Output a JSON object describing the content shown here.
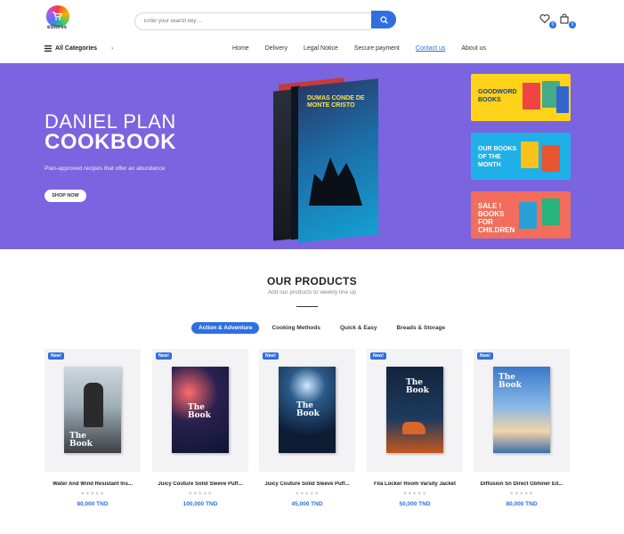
{
  "header": {
    "logo_text": "eStores",
    "search_placeholder": "Enter your search key ...",
    "wishlist_count": "0",
    "cart_count": "0"
  },
  "nav": {
    "all_categories": "All Categories",
    "links": [
      "Home",
      "Delivery",
      "Legal Notice",
      "Secure payment",
      "Contact us",
      "About us"
    ],
    "active": "Contact us"
  },
  "hero": {
    "title_line1": "DANIEL PLAN",
    "title_line2": "COOKBOOK",
    "subtitle": "Plan-approved recipes that offer an abundance",
    "cta": "SHOP NOW",
    "book_title": "DUMAS CONDE DE MONTE CRISTO",
    "promos": [
      {
        "text": "GOODWORD BOOKS",
        "bg": "#ffd31a",
        "color": "#1a3a8a"
      },
      {
        "text": "OUR BOOKS OF THE MONTH",
        "bg": "#1fb0e8",
        "color": "#ffffff"
      },
      {
        "text": "SALE ! BOOKS FOR CHILDREN",
        "bg": "#f26d5b",
        "color": "#ffffff"
      }
    ]
  },
  "products": {
    "title": "OUR PRODUCTS",
    "subtitle": "Add our products to weekly line up",
    "tabs": [
      "Action & Adventure",
      "Cooking Methods",
      "Quick & Easy",
      "Breads & Storage"
    ],
    "active_tab": "Action & Adventure",
    "badge": "New!",
    "cover_title": "The Book",
    "items": [
      {
        "name": "Water And Wind Resistant Ins...",
        "price": "80,000 TND"
      },
      {
        "name": "Juicy Couture Solid Sleeve Puff...",
        "price": "100,000 TND"
      },
      {
        "name": "Juicy Couture Solid Sleeve Puff...",
        "price": "45,000 TND"
      },
      {
        "name": "Fila Locker Room Varsity Jacket",
        "price": "50,000 TND"
      },
      {
        "name": "Diffusion Sn Direct Gbhiner Eit...",
        "price": "80,000 TND"
      }
    ]
  },
  "colors": {
    "accent": "#2f6fe0",
    "hero_bg": "#7a64e0"
  }
}
